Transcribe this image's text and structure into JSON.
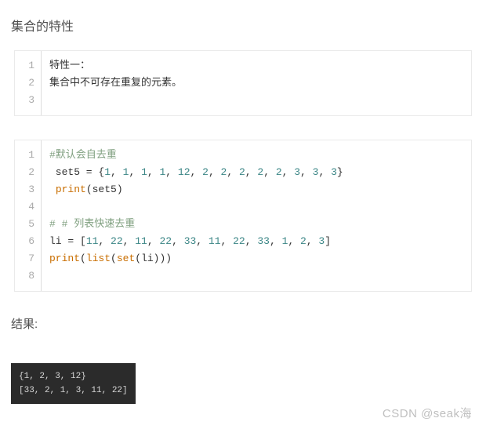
{
  "heading": "集合的特性",
  "block1": {
    "lines": [
      {
        "plain": "特性一："
      },
      {
        "plain": "集合中不可存在重复的元素。"
      },
      {
        "plain": ""
      }
    ]
  },
  "block2": {
    "lines": [
      {
        "type": "comment",
        "text": "#默认会自去重"
      },
      {
        "type": "set5"
      },
      {
        "type": "print_set5",
        "fn": "print",
        "var": "set5"
      },
      {
        "type": "blank"
      },
      {
        "type": "comment",
        "text": "# # 列表快速去重"
      },
      {
        "type": "li"
      },
      {
        "type": "print_li",
        "fn_print": "print",
        "fn_list": "list",
        "fn_set": "set",
        "var": "li"
      },
      {
        "type": "blank"
      }
    ],
    "set5_label": " set5 = {",
    "set5_values": [
      1,
      1,
      1,
      1,
      12,
      2,
      2,
      2,
      2,
      2,
      3,
      3,
      3
    ],
    "set5_close": "}",
    "li_label": "li = [",
    "li_values": [
      11,
      22,
      11,
      22,
      33,
      11,
      22,
      33,
      1,
      2,
      3
    ],
    "li_close": "]"
  },
  "result_label": "结果:",
  "terminal_lines": [
    "{1, 2, 3, 12}",
    "[33, 2, 1, 3, 11, 22]"
  ],
  "watermark": "CSDN @seak海"
}
